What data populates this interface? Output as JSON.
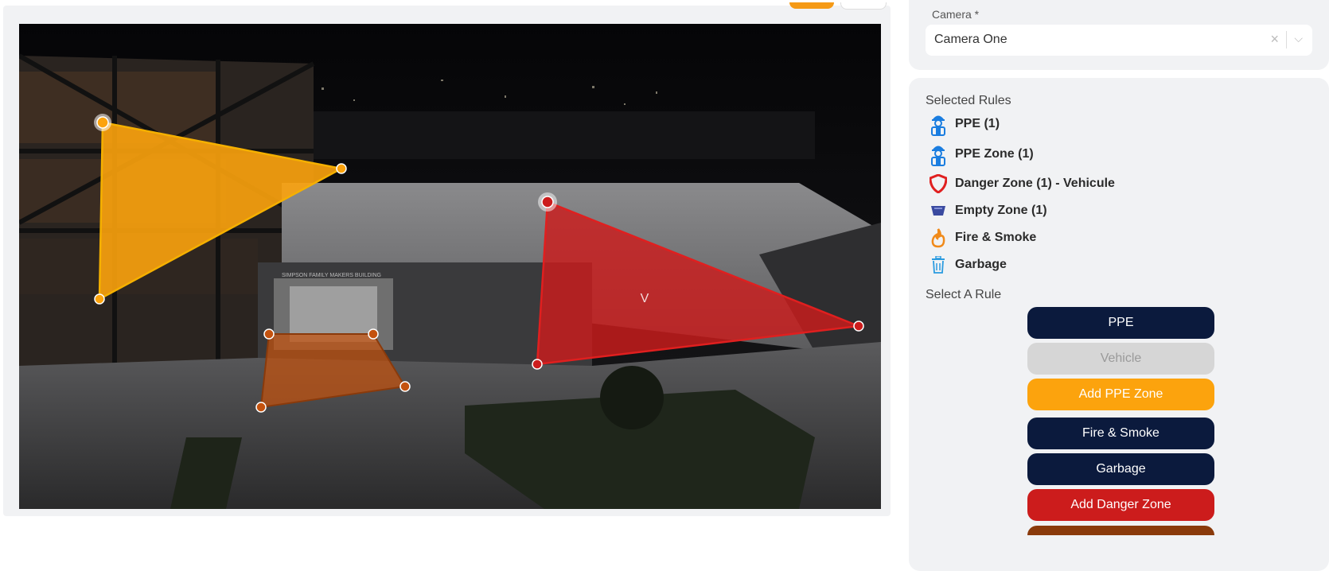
{
  "colors": {
    "navy": "#0b1a3d",
    "orange": "#fca30d",
    "danger": "#cc1c1c",
    "disabled": "#d6d6d6",
    "brown": "#c4520e"
  },
  "canvas": {
    "zone_label": "V",
    "sign_text": "SIMPSON FAMILY MAKERS BUILDING"
  },
  "camera": {
    "label": "Camera *",
    "value": "Camera One",
    "clear_glyph": "×",
    "chevron_glyph": "⌵"
  },
  "selected_rules": {
    "title": "Selected Rules",
    "items": [
      {
        "label": "PPE (1)",
        "icon": "worker-icon"
      },
      {
        "label": "PPE Zone (1)",
        "icon": "worker-icon"
      },
      {
        "label": "Danger Zone (1) - Vehicule",
        "icon": "shield-icon"
      },
      {
        "label": "Empty Zone (1)",
        "icon": "empty-zone-icon"
      },
      {
        "label": "Fire & Smoke",
        "icon": "fire-icon"
      },
      {
        "label": "Garbage",
        "icon": "trash-icon"
      }
    ]
  },
  "select_rule": {
    "title": "Select A Rule",
    "buttons": [
      {
        "label": "PPE"
      },
      {
        "label": "Vehicle"
      },
      {
        "label": "Add PPE Zone"
      },
      {
        "label": "Fire & Smoke"
      },
      {
        "label": "Garbage"
      },
      {
        "label": "Add Danger Zone"
      }
    ]
  }
}
